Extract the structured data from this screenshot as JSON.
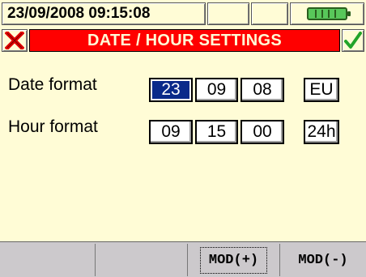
{
  "status_bar": {
    "datetime": "23/09/2008 09:15:08",
    "battery_icon": "battery-full-icon",
    "battery_color": "#58c85a"
  },
  "title_bar": {
    "title": "DATE / HOUR SETTINGS",
    "cancel_icon": "close-x-icon",
    "confirm_icon": "checkmark-icon",
    "title_bg": "#ff0000"
  },
  "settings": {
    "date_label": "Date format",
    "hour_label": "Hour format",
    "date_fields": [
      "23",
      "09",
      "08"
    ],
    "date_format_value": "EU",
    "hour_fields": [
      "09",
      "15",
      "00"
    ],
    "hour_format_value": "24h",
    "selected_field": "date_day",
    "selected_color": "#0a2a8a"
  },
  "function_keys": {
    "f1": "",
    "f2": "",
    "f3": "MOD(+)",
    "f4": "MOD(-)"
  }
}
